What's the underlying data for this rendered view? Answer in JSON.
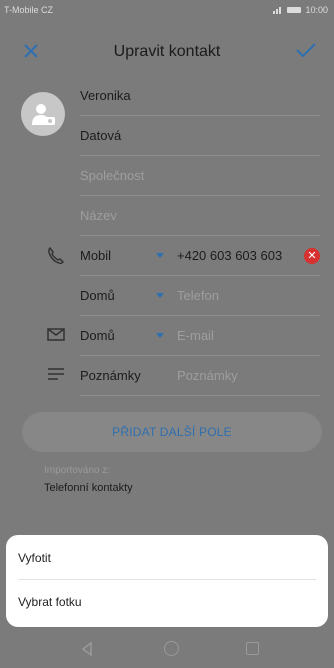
{
  "status_bar": {
    "carrier": "T-Mobile CZ",
    "time": "10:00"
  },
  "header": {
    "title": "Upravit kontakt"
  },
  "fields": {
    "first_name": "Veronika",
    "last_name": "Datová",
    "company_placeholder": "Společnost",
    "title_placeholder": "Název",
    "phone": {
      "type": "Mobil",
      "value": "+420 603 603 603"
    },
    "phone2": {
      "type": "Domů",
      "placeholder": "Telefon"
    },
    "email": {
      "type": "Domů",
      "placeholder": "E-mail"
    },
    "notes": {
      "label": "Poznámky",
      "placeholder": "Poznámky"
    }
  },
  "add_field_button": "PŘIDAT DALŠÍ POLE",
  "imported": {
    "label": "Importováno z:",
    "source": "Telefonní kontakty"
  },
  "sheet": {
    "items": [
      "Vyfotit",
      "Vybrat fotku"
    ]
  },
  "colors": {
    "accent": "#2f6fb0",
    "clear": "#d6312e",
    "dim_background": "#7b7b7b"
  }
}
